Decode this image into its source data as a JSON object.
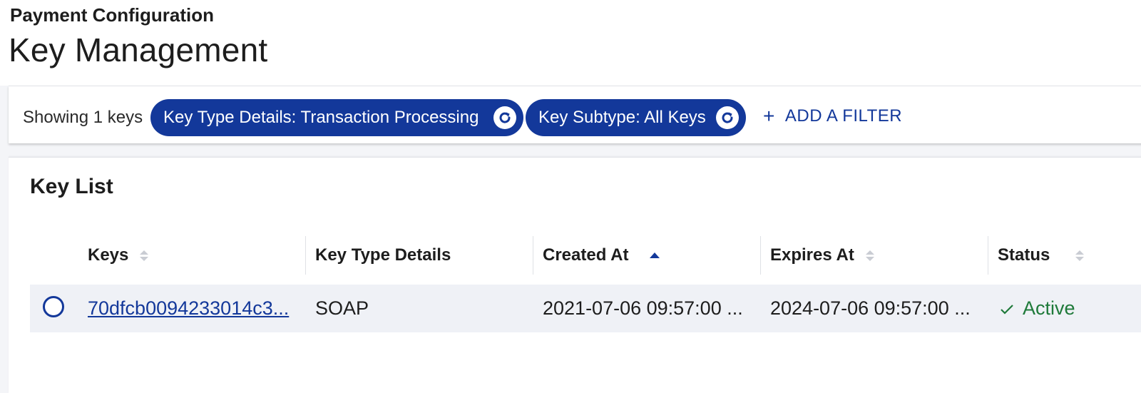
{
  "header": {
    "breadcrumb": "Payment Configuration",
    "title": "Key Management"
  },
  "filter_bar": {
    "showing": "Showing 1 keys",
    "chips": [
      {
        "label": "Key Type Details: Transaction Processing"
      },
      {
        "label": "Key Subtype: All Keys"
      }
    ],
    "add_filter": "ADD A FILTER",
    "add_filter_icon": "+"
  },
  "key_list": {
    "title": "Key List",
    "columns": [
      "Keys",
      "Key Type Details",
      "Created At",
      "Expires At",
      "Status"
    ],
    "sort": {
      "column": "Created At",
      "direction": "ascending"
    },
    "rows": [
      {
        "key": "70dfcb0094233014c3...",
        "type": "SOAP",
        "created": "2021-07-06 09:57:00 ...",
        "expires": "2024-07-06 09:57:00 ...",
        "status": "Active"
      }
    ]
  },
  "colors": {
    "accent": "#13389a",
    "status_active": "#1f7a3a",
    "row_bg": "#eff1f6"
  }
}
